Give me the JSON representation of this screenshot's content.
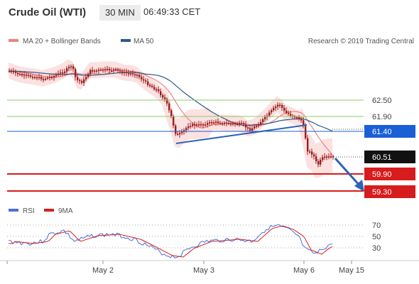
{
  "header": {
    "title": "Crude Oil (WTI)",
    "timeframe": "30 MIN",
    "time": "06:49:33 CET"
  },
  "price_legend": {
    "ma20_label": "MA 20 + Bollinger Bands",
    "ma50_label": "MA 50",
    "ma20_color": "#f08080",
    "ma50_color": "#2a5a8a",
    "copyright": "Research © 2019 Trading Central"
  },
  "rsi_legend": {
    "rsi_label": "RSI",
    "ma_label": "9MA",
    "rsi_color": "#4a6fd8",
    "ma_color": "#d42020"
  },
  "levels": [
    {
      "value": "62.50",
      "style": "green-line"
    },
    {
      "value": "61.90",
      "style": "green-line"
    },
    {
      "value": "61.40",
      "style": "blue-box"
    },
    {
      "value": "60.51",
      "style": "black-box"
    },
    {
      "value": "59.90",
      "style": "red-box"
    },
    {
      "value": "59.30",
      "style": "red-box"
    }
  ],
  "rsi_ticks": [
    "70",
    "50",
    "30"
  ],
  "x_axis": [
    "May 2",
    "May 3",
    "May 6",
    "May 15"
  ],
  "colors": {
    "candle": "#9b1c1c",
    "bollinger_fill": "#fbd9d9",
    "support_level": "#d61c1c",
    "pivot_level": "#1a5fd6",
    "resistance_level": "#8cc86a",
    "trendline": "#2e63b8"
  },
  "chart_data": {
    "type": "candlestick",
    "price_levels": [
      62.5,
      61.9,
      61.4,
      60.51,
      59.9,
      59.3
    ],
    "last_price": 60.51,
    "rsi_levels": [
      70,
      50,
      30
    ],
    "x_ticks": [
      "May 2",
      "May 3",
      "May 6",
      "May 15"
    ]
  }
}
